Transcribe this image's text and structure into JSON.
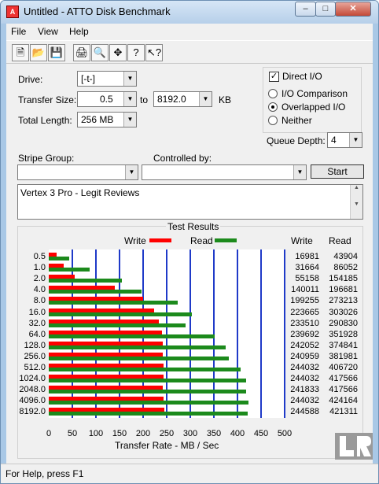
{
  "window": {
    "title": "Untitled - ATTO Disk Benchmark"
  },
  "menu": [
    "File",
    "View",
    "Help"
  ],
  "settings": {
    "drive_label": "Drive:",
    "drive_value": "[-t-]",
    "transfer_label": "Transfer Size:",
    "transfer_from": "0.5",
    "to_label": "to",
    "transfer_to": "8192.0",
    "unit": "KB",
    "length_label": "Total Length:",
    "length_value": "256 MB",
    "direct_io": "Direct I/O",
    "io_comparison": "I/O Comparison",
    "overlapped": "Overlapped I/O",
    "neither": "Neither",
    "queue_label": "Queue Depth:",
    "queue_value": "4",
    "stripe_label": "Stripe Group:",
    "controlled_label": "Controlled by:",
    "start_label": "Start"
  },
  "description": "Vertex 3 Pro - Legit Reviews",
  "results": {
    "group_label": "Test Results",
    "write_legend": "Write",
    "read_legend": "Read",
    "write_header": "Write",
    "read_header": "Read",
    "x_axis_label": "Transfer Rate - MB / Sec",
    "colors": {
      "write": "#ff0000",
      "read": "#1c8a1c",
      "grid": "#1f3ac8"
    }
  },
  "chart_data": {
    "type": "bar",
    "categories": [
      "0.5",
      "1.0",
      "2.0",
      "4.0",
      "8.0",
      "16.0",
      "32.0",
      "64.0",
      "128.0",
      "256.0",
      "512.0",
      "1024.0",
      "2048.0",
      "4096.0",
      "8192.0"
    ],
    "series": [
      {
        "name": "Write",
        "values": [
          16981,
          31664,
          55158,
          140011,
          199255,
          223665,
          233510,
          239692,
          242052,
          240959,
          244032,
          244032,
          241833,
          244032,
          244588
        ]
      },
      {
        "name": "Read",
        "values": [
          43904,
          86052,
          154185,
          196681,
          273213,
          303026,
          290830,
          351928,
          374841,
          381981,
          406720,
          417566,
          417566,
          424164,
          421311
        ]
      }
    ],
    "x_ticks": [
      "0",
      "50",
      "100",
      "150",
      "200",
      "250",
      "300",
      "350",
      "400",
      "450",
      "500"
    ],
    "xlim": [
      0,
      500
    ],
    "xlabel": "Transfer Rate - MB / Sec"
  },
  "status": "For Help, press F1"
}
